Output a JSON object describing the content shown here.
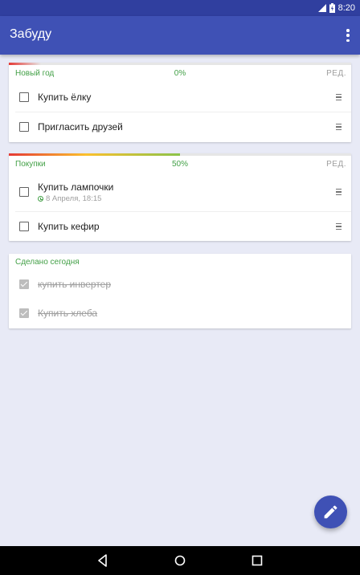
{
  "status_bar": {
    "time": "8:20"
  },
  "app_bar": {
    "title": "Забуду"
  },
  "lists": [
    {
      "name": "Новый год",
      "progress_label": "0%",
      "progress": 0.0,
      "edit_label": "РЕД.",
      "tasks": [
        {
          "text": "Купить ёлку"
        },
        {
          "text": "Пригласить друзей"
        }
      ]
    },
    {
      "name": "Покупки",
      "progress_label": "50%",
      "progress": 0.5,
      "edit_label": "РЕД.",
      "tasks": [
        {
          "text": "Купить лампочки",
          "reminder": "8 Апреля, 18:15"
        },
        {
          "text": "Купить кефир"
        }
      ]
    }
  ],
  "done_today": {
    "title": "Сделано сегодня",
    "tasks": [
      {
        "text": "купить инвертер"
      },
      {
        "text": "Купить хлеба"
      }
    ]
  },
  "colors": {
    "primary": "#3f51b5",
    "primary_dark": "#303f9f",
    "accent_green": "#43a047",
    "background": "#e8eaf6"
  },
  "icons": {
    "fab": "pencil-icon",
    "menu": "more-vert-icon",
    "drag": "drag-handle-icon"
  }
}
